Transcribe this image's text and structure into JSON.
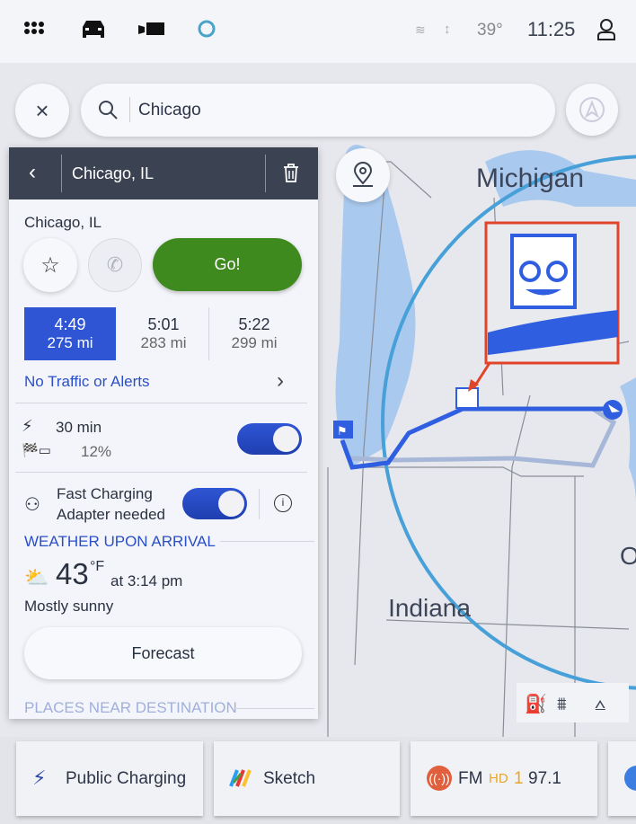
{
  "status_bar": {
    "temperature": "39°",
    "time": "11:25",
    "icons": [
      "apps-grid-icon",
      "car-icon",
      "camera-icon",
      "alexa-ring-icon",
      "wifi-icon",
      "signal-icon",
      "profile-icon"
    ]
  },
  "search": {
    "value": "Chicago",
    "icons": [
      "close-icon",
      "search-icon",
      "compass-icon"
    ]
  },
  "map": {
    "labels": [
      "Michigan",
      "Indiana",
      "O"
    ],
    "accent": "#2f5fe0"
  },
  "panel": {
    "header_title": "Chicago, IL",
    "destination": "Chicago, IL",
    "go_label": "Go!",
    "routes": [
      {
        "time": "4:49",
        "distance": "275 mi",
        "selected": true
      },
      {
        "time": "5:01",
        "distance": "283 mi"
      },
      {
        "time": "5:22",
        "distance": "299 mi"
      }
    ],
    "traffic": "No Traffic or Alerts",
    "charging": {
      "time": "30 min",
      "arrival_battery": "12%",
      "enabled": true
    },
    "adapter": {
      "line1": "Fast Charging",
      "line2": "Adapter needed",
      "enabled": true
    },
    "weather": {
      "heading": "WEATHER UPON ARRIVAL",
      "temp": "43",
      "unit": "°F",
      "time": "at 3:14 pm",
      "condition": "Mostly sunny"
    },
    "forecast_label": "Forecast",
    "places_heading": "PLACES NEAR DESTINATION"
  },
  "dock": [
    {
      "label": "Public Charging"
    },
    {
      "label": "Sketch"
    },
    {
      "label": "FM",
      "hd": "HD",
      "channel": "1",
      "freq": "97.1"
    }
  ],
  "colors": {
    "go": "#3f8a1f",
    "selected_route": "#2f55d4",
    "link": "#2a4fc7",
    "header": "#3b4352",
    "highlight_box": "#e0442a"
  }
}
